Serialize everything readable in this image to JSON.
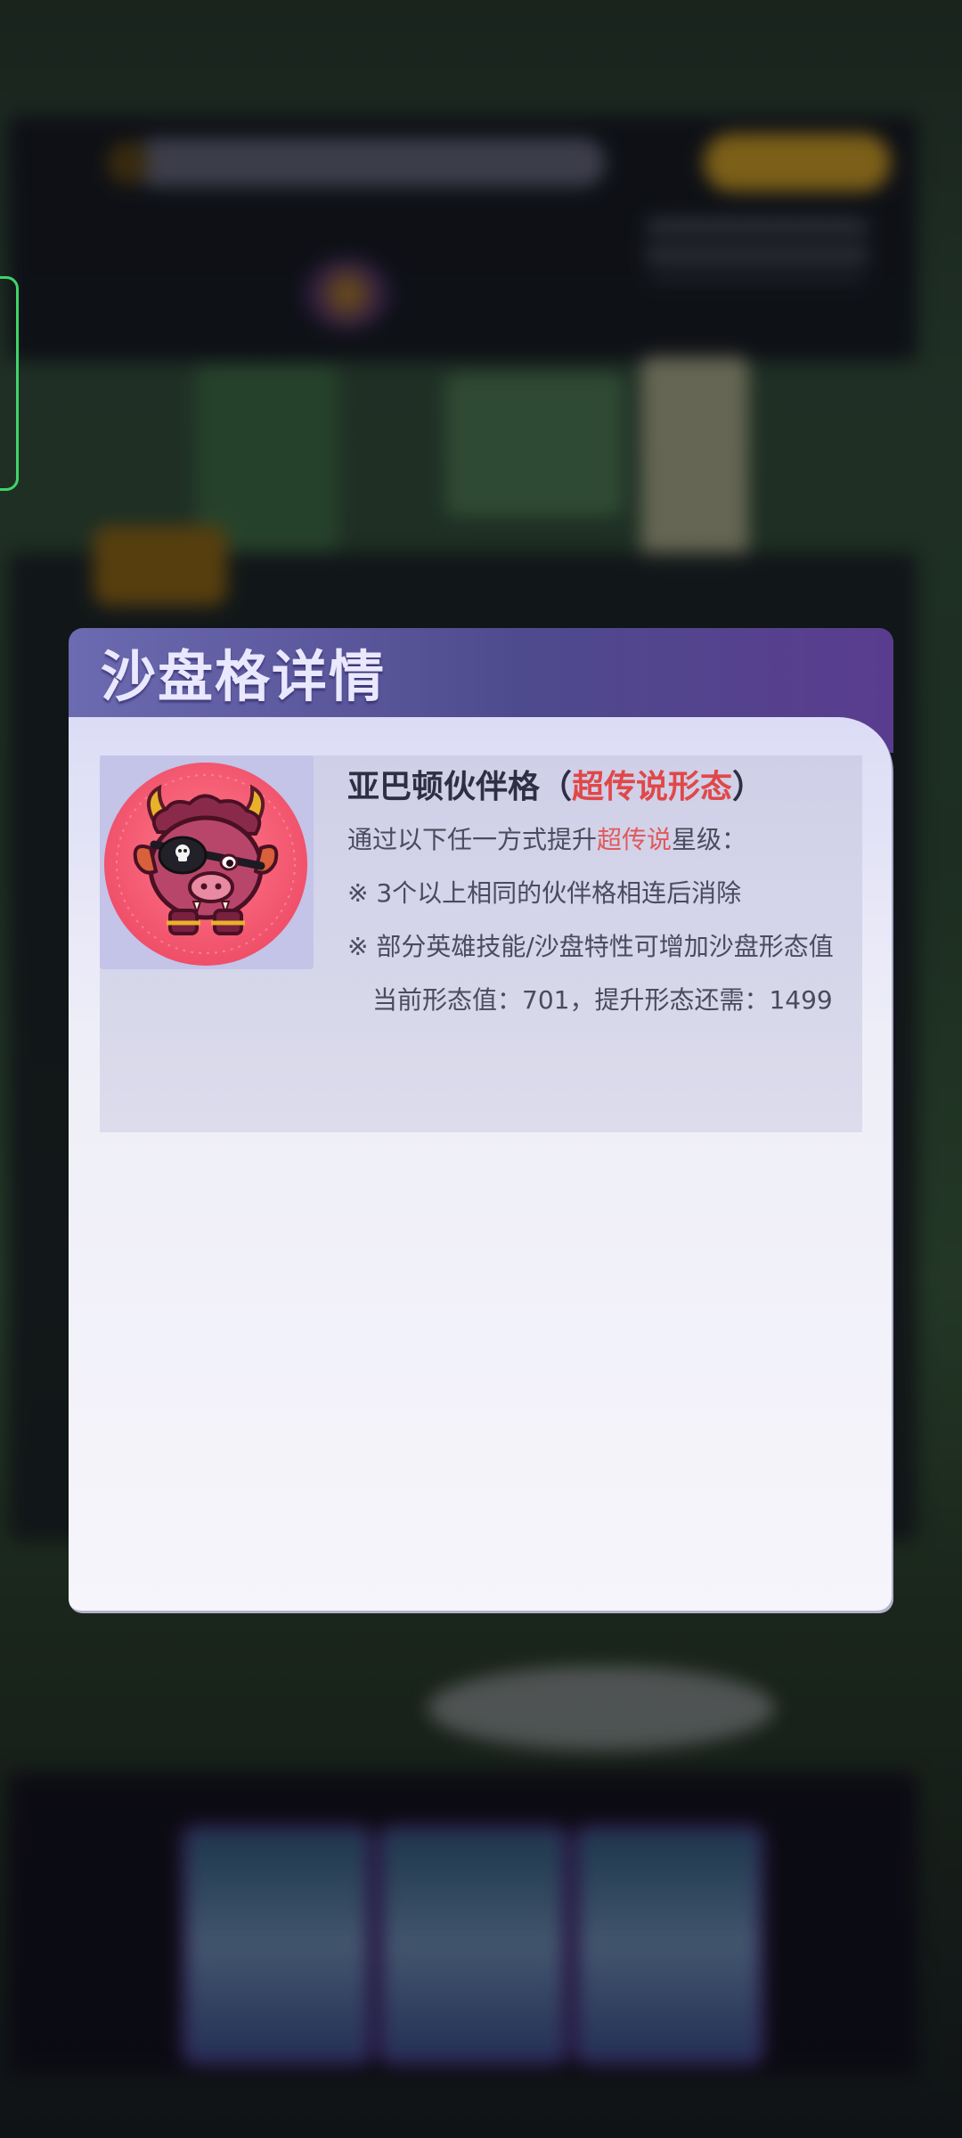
{
  "modal": {
    "title": "沙盘格详情",
    "hero": {
      "name_prefix": "亚巴顿伙伴格（",
      "name_form": "超传说形态",
      "name_suffix": "）",
      "avatar_icon": "pirate-demon-pig-icon"
    },
    "description": {
      "intro_prefix": "通过以下任一方式提升",
      "intro_highlight": "超传说",
      "intro_suffix": "星级：",
      "method_1": "※ 3个以上相同的伙伴格相连后消除",
      "method_2": "※ 部分英雄技能/沙盘特性可增加沙盘形态值",
      "status": "　当前形态值：701，提升形态还需：1499"
    }
  },
  "colors": {
    "accent_red": "#e04848",
    "header_purple": "#5a57a0",
    "body_lavender": "#e8e8f6"
  }
}
